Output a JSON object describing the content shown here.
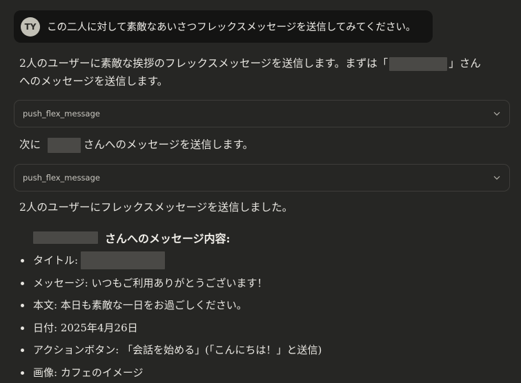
{
  "user_message": {
    "avatar_initials": "TY",
    "text": "この二人に対して素敵なあいさつフレックスメッセージを送信してみてください。"
  },
  "assistant": {
    "intro_line1_before": "2人のユーザーに素敵な挨拶のフレックスメッセージを送信します。まずは「",
    "intro_line1_after": "」さん",
    "intro_line2": "へのメッセージを送信します。",
    "tool_call_1": "push_flex_message",
    "next_prefix": "次に",
    "next_suffix": "さんへのメッセージを送信します。",
    "tool_call_2": "push_flex_message",
    "done_text": "2人のユーザーにフレックスメッセージを送信しました。",
    "details_heading": "さんへのメッセージ内容:",
    "details": [
      {
        "label": "タイトル:",
        "value": "",
        "redacted": true
      },
      {
        "label": "メッセージ:",
        "value": "いつもご利用ありがとうございます！",
        "redacted": false
      },
      {
        "label": "本文:",
        "value": "本日も素敵な一日をお過ごしください。",
        "redacted": false
      },
      {
        "label": "日付:",
        "value": "2025年4月26日",
        "redacted": false
      },
      {
        "label": "アクションボタン:",
        "value": "「会話を始める」(「こんにちは！」と送信)",
        "redacted": false
      },
      {
        "label": "画像:",
        "value": "カフェのイメージ",
        "redacted": false
      }
    ]
  },
  "icons": {
    "tool_expand": "chevron-down-icon"
  },
  "colors": {
    "background": "#262624",
    "user_bubble": "#141413",
    "avatar_bg": "#c2c0b6",
    "text": "#e8e6e1",
    "redaction": "#4a4946"
  }
}
